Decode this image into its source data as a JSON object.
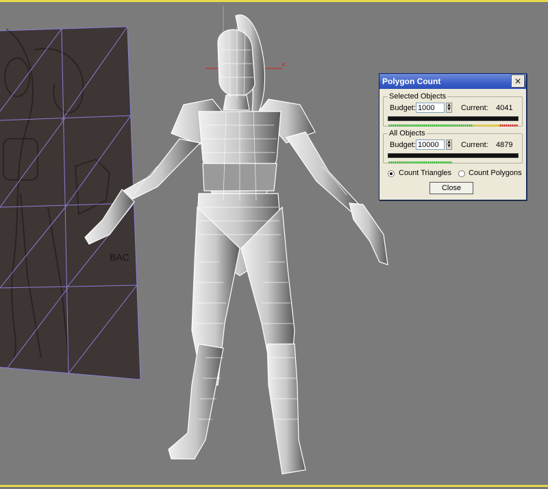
{
  "dialog": {
    "title": "Polygon Count",
    "close_x": "✕",
    "selected": {
      "legend": "Selected Objects",
      "budget_label": "Budget:",
      "budget_value": "1000",
      "current_label": "Current:",
      "current_value": "4041",
      "usage_fraction": 1.0
    },
    "all": {
      "legend": "All Objects",
      "budget_label": "Budget:",
      "budget_value": "10000",
      "current_label": "Current:",
      "current_value": "4879",
      "usage_fraction": 0.49
    },
    "radio_triangles": "Count Triangles",
    "radio_polygons": "Count Polygons",
    "selected_mode": "triangles",
    "close_button": "Close"
  },
  "reference_sketch_text": "BAC",
  "colors": {
    "viewport_bg": "#7b7b7b",
    "viewport_border": "#e6d94a",
    "wire": "#ffffff",
    "grid_line": "#8a80d8",
    "title_bar": "#3b5fc7"
  }
}
